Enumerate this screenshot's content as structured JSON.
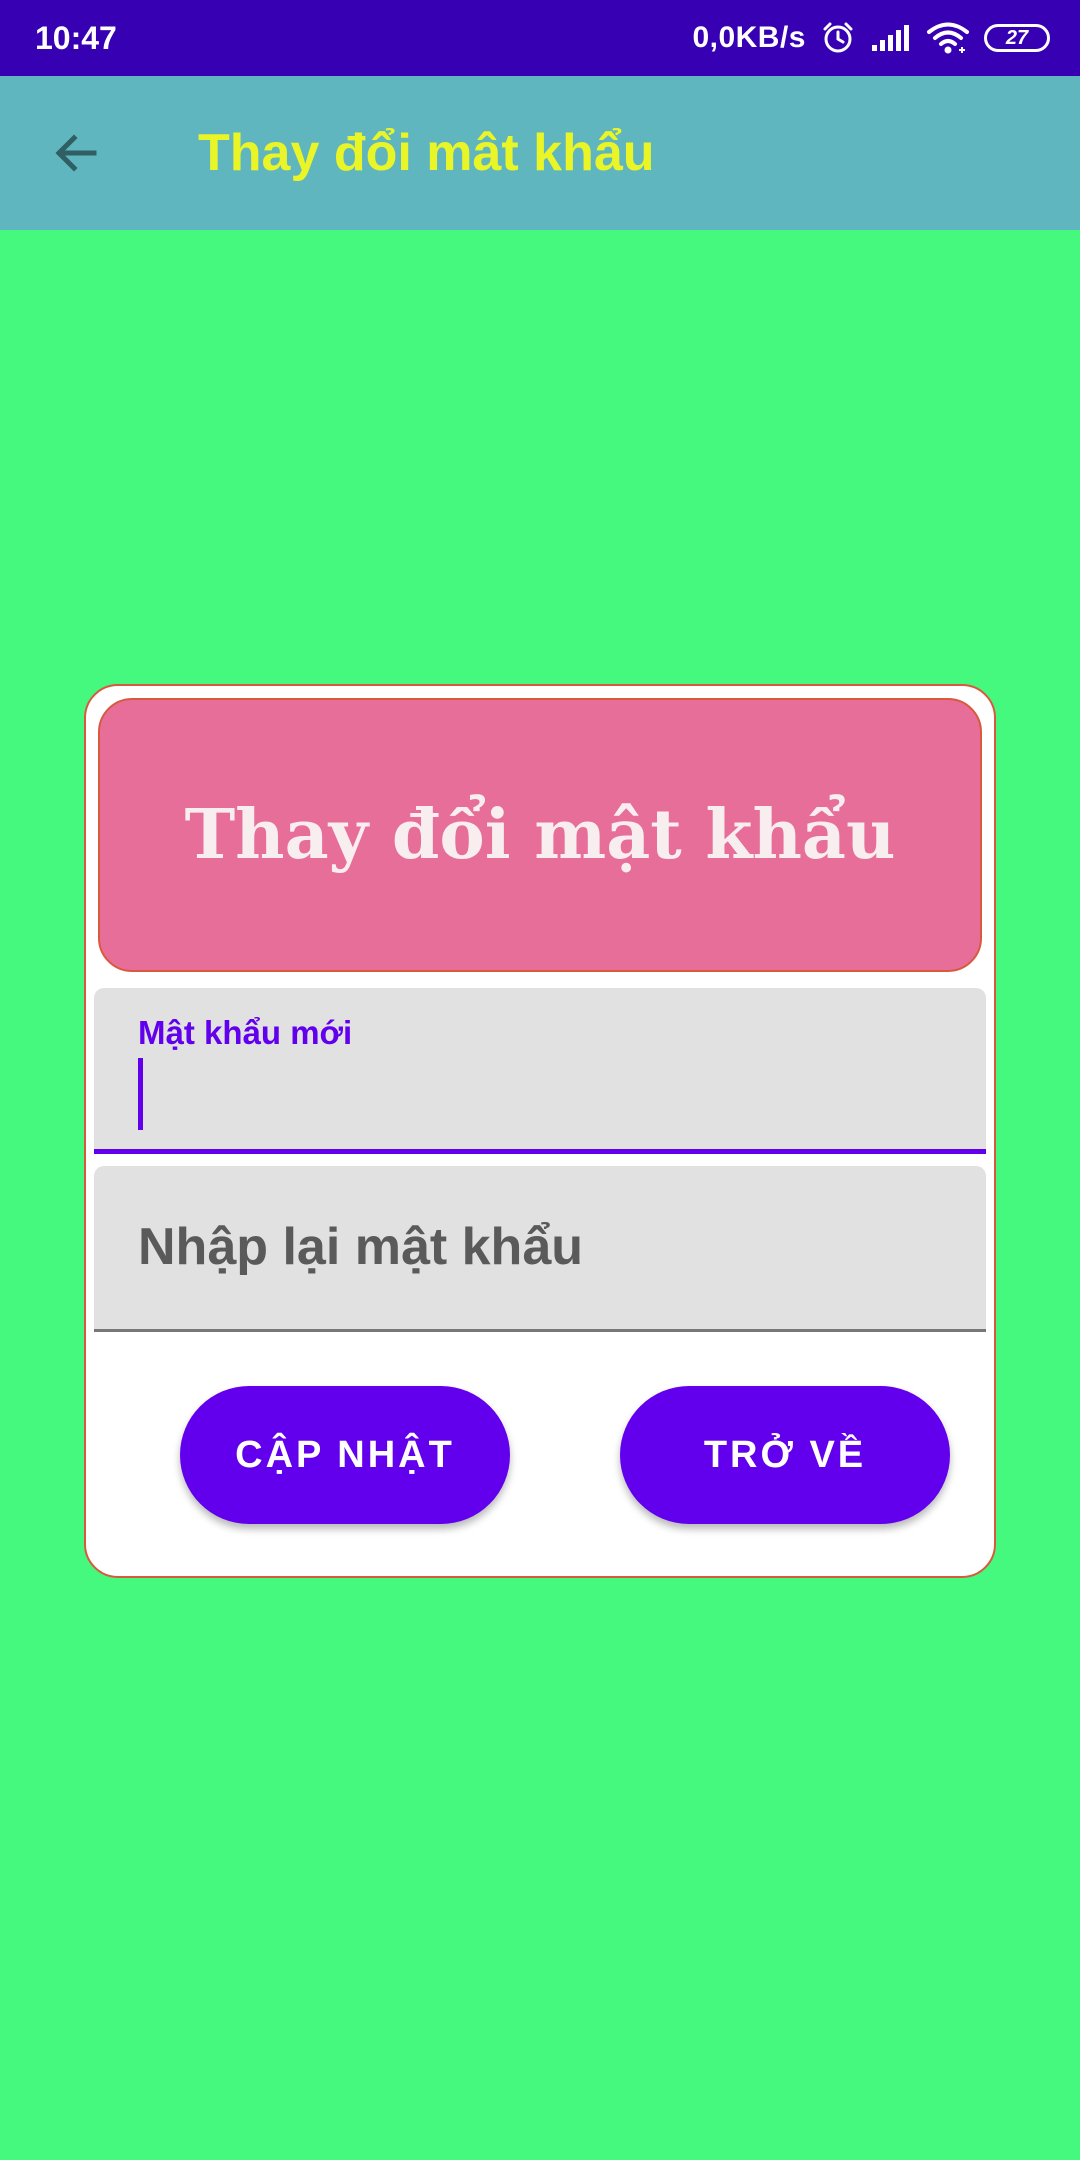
{
  "status_bar": {
    "time": "10:47",
    "network_speed": "0,0KB/s",
    "battery_level": "27",
    "icons": [
      "alarm-icon",
      "signal-icon",
      "wifi-icon",
      "battery-icon"
    ]
  },
  "app_bar": {
    "title": "Thay đổi mât khẩu",
    "back_icon": "arrow-back-icon"
  },
  "card": {
    "header_title": "Thay đổi mật khẩu",
    "new_password_field": {
      "label": "Mật khẩu mới",
      "value": ""
    },
    "confirm_password_field": {
      "placeholder": "Nhập lại mật khẩu",
      "value": ""
    },
    "update_button_label": "CẬP NHẬT",
    "back_button_label": "TRỞ VỀ"
  },
  "colors": {
    "status_bar": "#3700B3",
    "app_bar": "#5FB6BF",
    "app_title": "#E9F527",
    "background": "#44F97E",
    "card_header": "#E76E98",
    "accent": "#6200EE",
    "card_border": "#D9593F"
  }
}
